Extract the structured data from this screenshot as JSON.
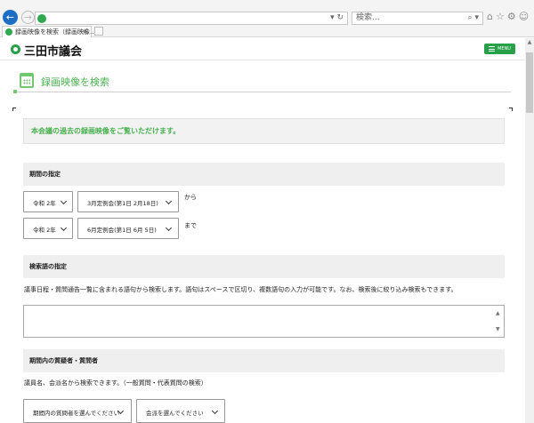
{
  "browser": {
    "search_placeholder": "検索...",
    "address_tools": "▾ ↻",
    "search_tools": "⌕ ▾",
    "toolbar_icons": "⌂☆⚙☺",
    "tab_label": "録画映像を検索（録画映像...",
    "tab_close": "×"
  },
  "site": {
    "title": "三田市議会",
    "menu_label": "MENU"
  },
  "page": {
    "title": "録画映像を検索",
    "intro": "本会議の過去の録画映像をご覧いただけます。"
  },
  "period": {
    "heading": "期間の指定",
    "from": {
      "era": "令和 2年",
      "session": "3月定例会(第1日 2月18日)",
      "suffix": "から"
    },
    "to": {
      "era": "令和 2年",
      "session": "6月定例会(第1日 6月 5日)",
      "suffix": "まで"
    }
  },
  "keyword": {
    "heading": "検索語の指定",
    "description": "議事日程・質問通告一覧に含まれる語句から検索します。語句はスペースで区切り、複数語句の入力が可能です。なお、検索後に絞り込み検索もできます。",
    "value": "",
    "scroll_up": "▲",
    "scroll_down": "▼"
  },
  "questioner": {
    "heading": "期間内の質疑者・質問者",
    "description": "議員名、会派名から検索できます。（一般質問・代表質問の検索）",
    "member_select": "期間内の質問者を選んでください",
    "party_select": "会派を選んでください"
  },
  "colors": {
    "accent_green": "#26a148",
    "text_green": "#48b04e",
    "section_bg": "#efefef"
  },
  "icons": [
    "back-icon",
    "forward-icon",
    "city-logo-icon",
    "menu-icon",
    "calendar-icon",
    "chevron-down-icon"
  ]
}
